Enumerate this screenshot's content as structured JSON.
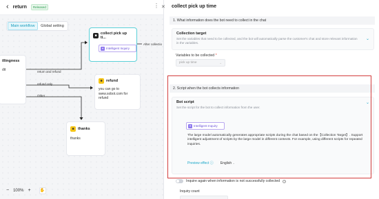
{
  "header": {
    "back_icon": "chevron-left-icon",
    "title": "return",
    "badge": "Released",
    "menu_icon": "kebab-icon"
  },
  "workflow_tabs": [
    "Main workflow",
    "Global setting"
  ],
  "nodes": {
    "collect": {
      "icon": "chat-icon",
      "title": "collect pick up ti...",
      "pill_icon": "ai-icon",
      "pill": "Intelligent Inquiry"
    },
    "left": {
      "title": "illingness",
      "body": "dit"
    },
    "refund": {
      "icon": "chat-icon",
      "title": "refund",
      "body": "you can go to www.sobot.com for refund"
    },
    "thanks": {
      "icon": "chat-icon",
      "title": "thanks",
      "body": "thanks"
    }
  },
  "edges": {
    "return_refund": "return and refund",
    "refund_only": "refund only",
    "other": "Other",
    "after": "After collectio"
  },
  "zoom": {
    "minus": "−",
    "level": "100%",
    "plus": "+",
    "hand_icon": "hand-icon"
  },
  "panel": {
    "title": "collect pick up time",
    "close_icon": "close-icon",
    "section1": "1. What information does the bot need to collect in the chat",
    "collection_target": {
      "title": "Collection target",
      "desc": "Set the variables that need to be collected, and the bot will automatically parse the customer's chat and store relevant information in the variables.",
      "chevron_icon": "chevron-down-icon"
    },
    "variables_label": "Variables to be collected",
    "required_mark": "*",
    "variables_value": "pick up time",
    "variables_dropdown_icon": "chevron-down-icon",
    "section2": "2. Script when the bot collects information",
    "bot_script": {
      "title": "Bot script",
      "desc": "Set the script for the bot to collect information from the user.",
      "chevron_icon": "chevron-down-icon",
      "pill_icon": "ai-icon",
      "pill": "Intelligent Inquiry",
      "text": "The large model automatically generates appropriate scripts during the chat based on the【Collection Target】. Support intelligent adjustment of scripts by the large model in different contexts. For example, using different scripts for repeated inquiries.",
      "preview": "Preview effect",
      "preview_info_icon": "info-icon",
      "language": "English",
      "language_dropdown_icon": "chevron-down-icon"
    },
    "inquire_again": "Inquire again when information is not successfully collected",
    "inquire_help_icon": "question-icon",
    "inquiry_count": "Inquiry count"
  },
  "colors": {
    "accent": "#1aa6c8",
    "ai_purple": "#6950d8",
    "highlight_red": "#d23c3c",
    "node_yellow": "#f5c518"
  }
}
